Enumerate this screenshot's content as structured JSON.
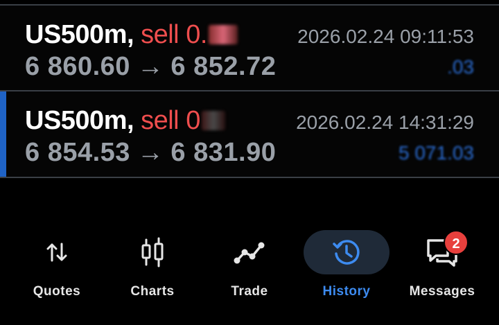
{
  "deals": [
    {
      "symbol": "US500m,",
      "type": "sell",
      "volume_visible": "0.",
      "open_price": "6 860.60",
      "arrow": "→",
      "close_price": "6 852.72",
      "time": "2026.02.24 09:11:53",
      "profit_visible": ".03"
    },
    {
      "symbol": "US500m,",
      "type": "sell",
      "volume_visible": "0",
      "open_price": "6 854.53",
      "arrow": "→",
      "close_price": "6 831.90",
      "time": "2026.02.24 14:31:29",
      "profit_visible": "5 071.03"
    }
  ],
  "nav": {
    "quotes": {
      "label": "Quotes",
      "icon": "sort-arrows-icon"
    },
    "charts": {
      "label": "Charts",
      "icon": "candlestick-icon"
    },
    "trade": {
      "label": "Trade",
      "icon": "trend-line-icon"
    },
    "history": {
      "label": "History",
      "icon": "history-clock-icon",
      "active": true
    },
    "messages": {
      "label": "Messages",
      "icon": "chat-bubbles-icon",
      "badge": "2"
    }
  },
  "colors": {
    "background": "#000000",
    "sell": "#ef4e4e",
    "price": "#9aa0a8",
    "profit": "#2b6ed6",
    "active_nav": "#3d8bf0",
    "accent_bar": "#1f63c6",
    "badge": "#e8403d"
  }
}
